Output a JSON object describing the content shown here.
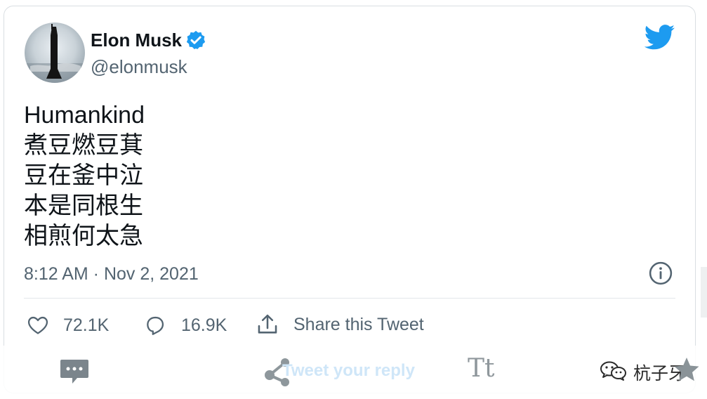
{
  "author": {
    "name": "Elon Musk",
    "handle": "@elonmusk",
    "verified": true
  },
  "tweet": {
    "lines": [
      "Humankind",
      "煮豆燃豆萁",
      "豆在釜中泣",
      "本是同根生",
      "相煎何太急"
    ],
    "timestamp": "8:12 AM · Nov 2, 2021"
  },
  "actions": {
    "like_count": "72.1K",
    "reply_count": "16.9K",
    "share_label": "Share this Tweet"
  },
  "reply_bar": {
    "placeholder": "Tweet your reply",
    "text_size_label": "Tt"
  },
  "watermark": {
    "name": "杭子牙"
  },
  "icons": {
    "brand": "twitter-bird-icon",
    "verified": "verified-badge-icon",
    "info": "info-icon",
    "like": "heart-icon",
    "reply": "comment-icon",
    "share": "share-upload-icon",
    "chat": "chat-bubble-icon",
    "share_nodes": "share-nodes-icon",
    "wechat": "wechat-icon",
    "star": "star-icon"
  },
  "colors": {
    "brand_blue": "#1d9bf0",
    "text_primary": "#0f1419",
    "text_secondary": "#536471",
    "placeholder_blue": "#cfe6f8"
  }
}
